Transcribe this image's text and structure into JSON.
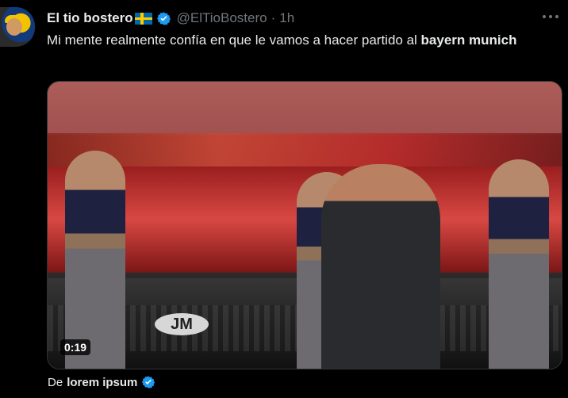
{
  "tweet": {
    "author_name": "El tio bostero",
    "handle": "@ElTioBostero",
    "separator": "·",
    "time": "1h",
    "text_parts": {
      "part1": "Mi mente realmente confía en que le vamos a hacer partido al ",
      "part2": "bayern munich"
    },
    "media": {
      "duration": "0:19",
      "logo_text": "JM"
    },
    "source": {
      "prefix": "De",
      "author": "lorem ipsum"
    }
  },
  "colors": {
    "background": "#000000",
    "text": "#e7e9ea",
    "muted": "#71767b",
    "verified": "#1d9bf0"
  },
  "icons": [
    "avatar",
    "flag-sweden-icon",
    "verified-badge-icon",
    "more-options-icon"
  ]
}
